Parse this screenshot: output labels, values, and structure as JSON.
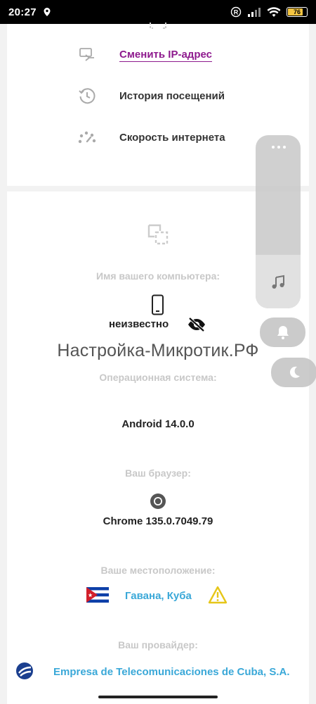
{
  "status_bar": {
    "time": "20:27",
    "battery_level": "76",
    "battery_color": "#f4c542"
  },
  "menu": {
    "change_ip": "Сменить IP-адрес",
    "history": "История посещений",
    "speed": "Скорость интернета"
  },
  "computer": {
    "label": "Имя вашего компьютера:",
    "name": "неизвестно"
  },
  "watermark": "Настройка-Микротик.РФ",
  "os": {
    "label": "Операционная система:",
    "value": "Android 14.0.0"
  },
  "browser": {
    "label": "Ваш браузер:",
    "value": "Chrome 135.0.7049.79"
  },
  "location": {
    "label": "Ваше местоположение:",
    "value": "Гавана, Куба"
  },
  "provider": {
    "label": "Ваш провайдер:",
    "value": "Empresa de Telecomunicaciones de Cuba, S.A."
  },
  "colors": {
    "link_purple": "#8e1a8e",
    "accent_blue": "#3aa8d8",
    "warning_yellow": "#e6c619"
  },
  "icons": [
    "location-pin-icon",
    "registered-icon",
    "signal-icon",
    "wifi-icon",
    "battery-icon",
    "change-ip-icon",
    "history-icon",
    "speedometer-icon",
    "computer-frame-icon",
    "phone-icon",
    "eye-off-icon",
    "chrome-icon",
    "cuba-flag-icon",
    "warning-icon",
    "provider-logo-icon",
    "more-dots-icon",
    "music-note-icon",
    "bell-icon",
    "moon-icon"
  ]
}
